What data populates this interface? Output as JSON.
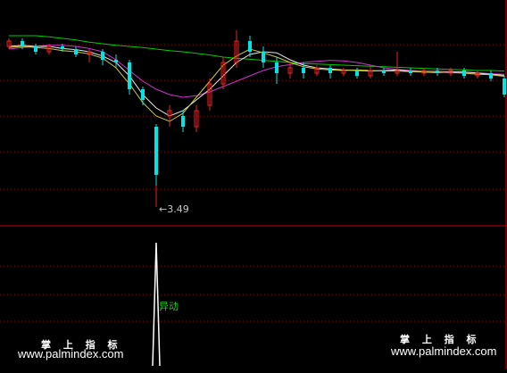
{
  "chart_data": [
    {
      "type": "candlestick",
      "panel": "price",
      "ma_series": [
        {
          "color": "#00cc00",
          "values": [
            9.1,
            9.1,
            9.1,
            9.08,
            9.05,
            9.02,
            8.98,
            8.95,
            8.92,
            8.9,
            8.88,
            8.85,
            8.82,
            8.8,
            8.77,
            8.74,
            8.7,
            8.68,
            8.66,
            8.64,
            8.62,
            8.6,
            8.58,
            8.57,
            8.56,
            8.55,
            8.54,
            8.53,
            8.52,
            8.51,
            8.5,
            8.49,
            8.48,
            8.47,
            8.46,
            8.45,
            8.45,
            8.44
          ]
        },
        {
          "color": "#cc33cc",
          "values": [
            8.85,
            8.88,
            8.9,
            8.92,
            8.92,
            8.9,
            8.86,
            8.8,
            8.65,
            8.45,
            8.25,
            8.1,
            8.0,
            7.95,
            7.98,
            8.05,
            8.15,
            8.25,
            8.35,
            8.45,
            8.52,
            8.56,
            8.6,
            8.62,
            8.64,
            8.63,
            8.6,
            8.55,
            8.5,
            8.47,
            8.45,
            8.44,
            8.44,
            8.43,
            8.42,
            8.41,
            8.39,
            8.38
          ]
        },
        {
          "color": "#e8e8e8",
          "values": [
            8.9,
            8.92,
            8.9,
            8.9,
            8.86,
            8.84,
            8.8,
            8.72,
            8.6,
            8.35,
            8.0,
            7.75,
            7.6,
            7.7,
            7.9,
            8.1,
            8.35,
            8.6,
            8.75,
            8.8,
            8.78,
            8.65,
            8.55,
            8.5,
            8.48,
            8.46,
            8.45,
            8.44,
            8.45,
            8.46,
            8.44,
            8.42,
            8.41,
            8.42,
            8.42,
            8.4,
            8.38,
            8.36
          ]
        },
        {
          "color": "#cccc33",
          "values": [
            8.88,
            8.9,
            8.88,
            8.86,
            8.82,
            8.8,
            8.76,
            8.68,
            8.5,
            8.2,
            7.85,
            7.6,
            7.5,
            7.65,
            7.95,
            8.25,
            8.55,
            8.72,
            8.85,
            8.78,
            8.7,
            8.6,
            8.52,
            8.48,
            8.46,
            8.45,
            8.46,
            8.45,
            8.44,
            8.44,
            8.43,
            8.42,
            8.42,
            8.41,
            8.4,
            8.38,
            8.37,
            8.34
          ]
        }
      ],
      "candles": [
        {
          "o": 8.9,
          "c": 9.0,
          "h": 9.05,
          "l": 8.85
        },
        {
          "o": 9.0,
          "c": 8.9,
          "h": 9.05,
          "l": 8.85
        },
        {
          "o": 8.9,
          "c": 8.8,
          "h": 8.95,
          "l": 8.75
        },
        {
          "o": 8.8,
          "c": 8.9,
          "h": 8.95,
          "l": 8.75
        },
        {
          "o": 8.9,
          "c": 8.85,
          "h": 8.95,
          "l": 8.8
        },
        {
          "o": 8.85,
          "c": 8.75,
          "h": 8.9,
          "l": 8.7
        },
        {
          "o": 8.75,
          "c": 8.8,
          "h": 8.85,
          "l": 8.6
        },
        {
          "o": 8.8,
          "c": 8.65,
          "h": 8.85,
          "l": 8.55
        },
        {
          "o": 8.65,
          "c": 8.6,
          "h": 8.75,
          "l": 8.5
        },
        {
          "o": 8.6,
          "c": 8.1,
          "h": 8.65,
          "l": 8.0
        },
        {
          "o": 8.1,
          "c": 7.9,
          "h": 8.15,
          "l": 7.8
        },
        {
          "o": 7.4,
          "c": 6.5,
          "h": 7.45,
          "l": 6.3
        },
        {
          "o": 7.6,
          "c": 7.7,
          "h": 7.8,
          "l": 7.4
        },
        {
          "o": 7.6,
          "c": 7.4,
          "h": 7.7,
          "l": 7.3
        },
        {
          "o": 7.4,
          "c": 7.7,
          "h": 7.8,
          "l": 7.3
        },
        {
          "o": 7.8,
          "c": 8.2,
          "h": 8.3,
          "l": 7.7
        },
        {
          "o": 8.2,
          "c": 8.6,
          "h": 8.7,
          "l": 8.1
        },
        {
          "o": 8.6,
          "c": 9.0,
          "h": 9.2,
          "l": 8.5
        },
        {
          "o": 9.0,
          "c": 8.8,
          "h": 9.1,
          "l": 8.7
        },
        {
          "o": 8.8,
          "c": 8.6,
          "h": 8.9,
          "l": 8.5
        },
        {
          "o": 8.6,
          "c": 8.4,
          "h": 8.7,
          "l": 8.2
        },
        {
          "o": 8.4,
          "c": 8.5,
          "h": 8.6,
          "l": 8.3
        },
        {
          "o": 8.5,
          "c": 8.4,
          "h": 8.6,
          "l": 8.3
        },
        {
          "o": 8.4,
          "c": 8.5,
          "h": 8.55,
          "l": 8.35
        },
        {
          "o": 8.5,
          "c": 8.4,
          "h": 8.55,
          "l": 8.3
        },
        {
          "o": 8.4,
          "c": 8.45,
          "h": 8.5,
          "l": 8.35
        },
        {
          "o": 8.45,
          "c": 8.35,
          "h": 8.5,
          "l": 8.3
        },
        {
          "o": 8.35,
          "c": 8.45,
          "h": 8.55,
          "l": 8.3
        },
        {
          "o": 8.45,
          "c": 8.4,
          "h": 8.5,
          "l": 8.35
        },
        {
          "o": 8.4,
          "c": 8.45,
          "h": 8.8,
          "l": 8.35
        },
        {
          "o": 8.45,
          "c": 8.4,
          "h": 8.5,
          "l": 8.35
        },
        {
          "o": 8.4,
          "c": 8.45,
          "h": 8.5,
          "l": 8.35
        },
        {
          "o": 8.45,
          "c": 8.4,
          "h": 8.5,
          "l": 8.35
        },
        {
          "o": 8.4,
          "c": 8.45,
          "h": 8.5,
          "l": 8.35
        },
        {
          "o": 8.45,
          "c": 8.35,
          "h": 8.5,
          "l": 8.3
        },
        {
          "o": 8.35,
          "c": 8.4,
          "h": 8.45,
          "l": 8.3
        },
        {
          "o": 8.4,
          "c": 8.3,
          "h": 8.45,
          "l": 8.25
        },
        {
          "o": 8.3,
          "c": 8.0,
          "h": 8.35,
          "l": 7.95
        }
      ],
      "low_marker": {
        "label": "3.49",
        "candle_index": 11
      },
      "ylim": [
        5.6,
        9.6
      ]
    },
    {
      "type": "area",
      "panel": "indicator",
      "values": [
        0,
        0,
        0,
        0,
        0,
        0,
        0,
        0,
        0,
        0,
        0,
        1,
        0,
        0,
        0,
        0,
        0,
        0,
        0,
        0,
        0,
        0,
        0,
        0,
        0,
        0,
        0,
        0,
        0,
        0,
        0,
        0,
        0,
        0,
        0,
        0,
        0,
        0
      ],
      "ylim": [
        0,
        1
      ],
      "signal_label": "异动"
    }
  ],
  "colors": {
    "up": "#ee2222",
    "down": "#00e5e5",
    "grid": "#990000",
    "separator": "#cc0000",
    "signal_text": "#22cc22",
    "spike": "#ffffff"
  },
  "watermark": {
    "left_title": "掌 上 指 标",
    "left_url": "www.palmindex.com",
    "right_title": "掌 上 指 标",
    "right_url": "www.palmindex.com"
  }
}
